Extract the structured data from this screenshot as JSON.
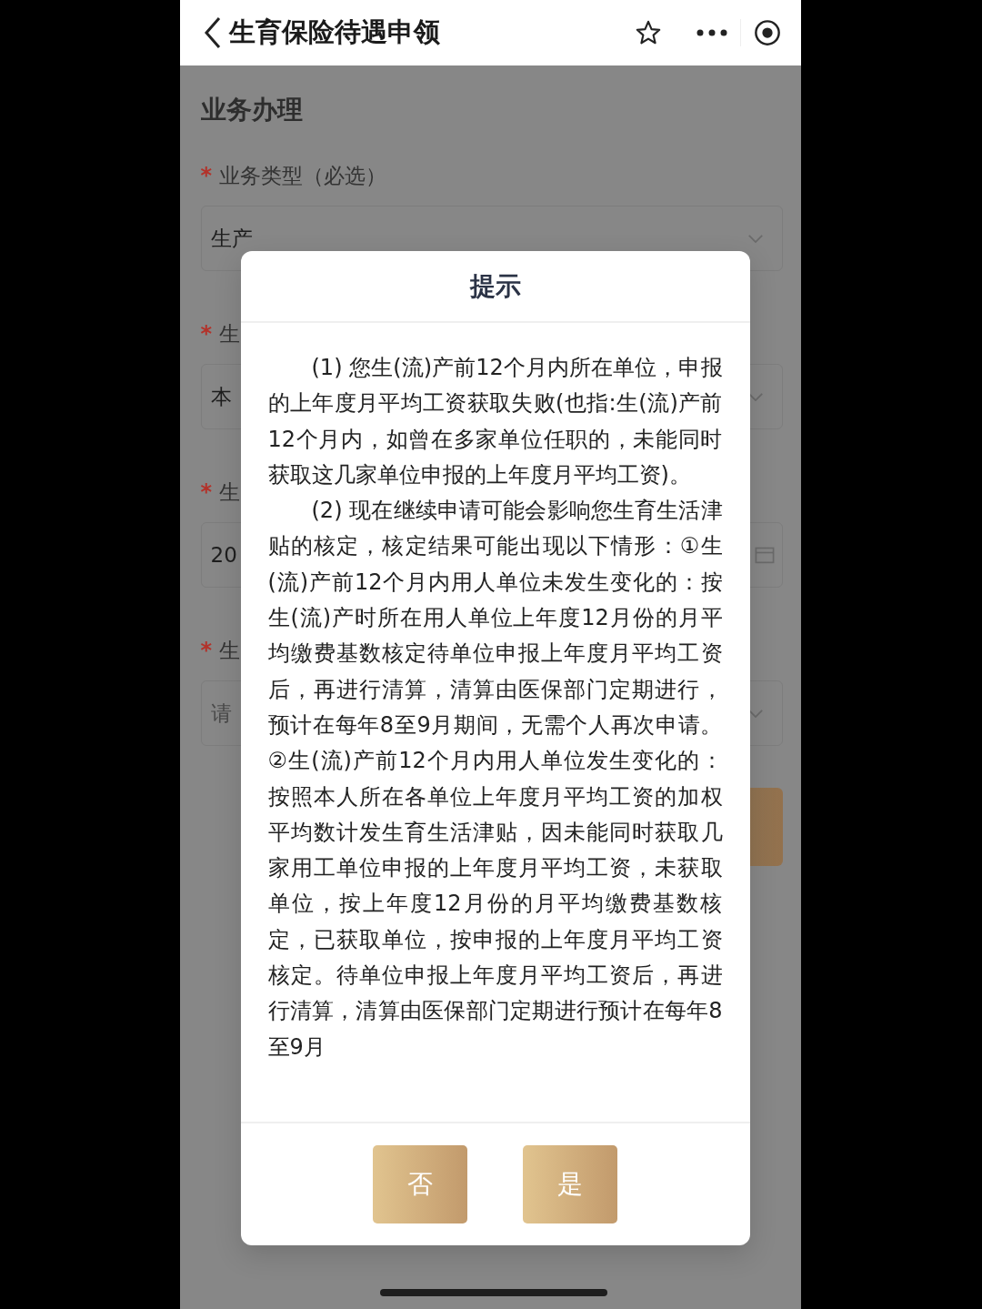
{
  "header": {
    "title": "生育保险待遇申领"
  },
  "form": {
    "heading": "业务办理",
    "fields": [
      {
        "marker": "*",
        "label": "业务类型（必选）",
        "kind": "select",
        "value": "生产"
      },
      {
        "marker": "*",
        "label": "生",
        "kind": "select",
        "value": "本"
      },
      {
        "marker": "*",
        "label": "生",
        "kind": "date",
        "value": "20"
      },
      {
        "marker": "*",
        "label": "生",
        "kind": "select",
        "placeholder": "请"
      }
    ]
  },
  "dialog": {
    "title": "提示",
    "paragraphs": [
      "(1) 您生(流)产前12个月内所在单位，申报的上年度月平均工资获取失败(也指:生(流)产前12个月内，如曾在多家单位任职的，未能同时获取这几家单位申报的上年度月平均工资)。",
      "(2) 现在继续申请可能会影响您生育生活津贴的核定，核定结果可能出现以下情形：①生(流)产前12个月内用人单位未发生变化的：按生(流)产时所在用人单位上年度12月份的月平均缴费基数核定待单位申报上年度月平均工资后，再进行清算，清算由医保部门定期进行，预计在每年8至9月期间，无需个人再次申请。②生(流)产前12个月内用人单位发生变化的：按照本人所在各单位上年度月平均工资的加权平均数计发生育生活津贴，因未能同时获取几家用工单位申报的上年度月平均工资，未获取单位，按上年度12月份的月平均缴费基数核定，已获取单位，按申报的上年度月平均工资核定。待单位申报上年度月平均工资后，再进行清算，清算由医保部门定期进行预计在每年8至9月"
    ],
    "buttons": [
      "否",
      "是"
    ]
  }
}
